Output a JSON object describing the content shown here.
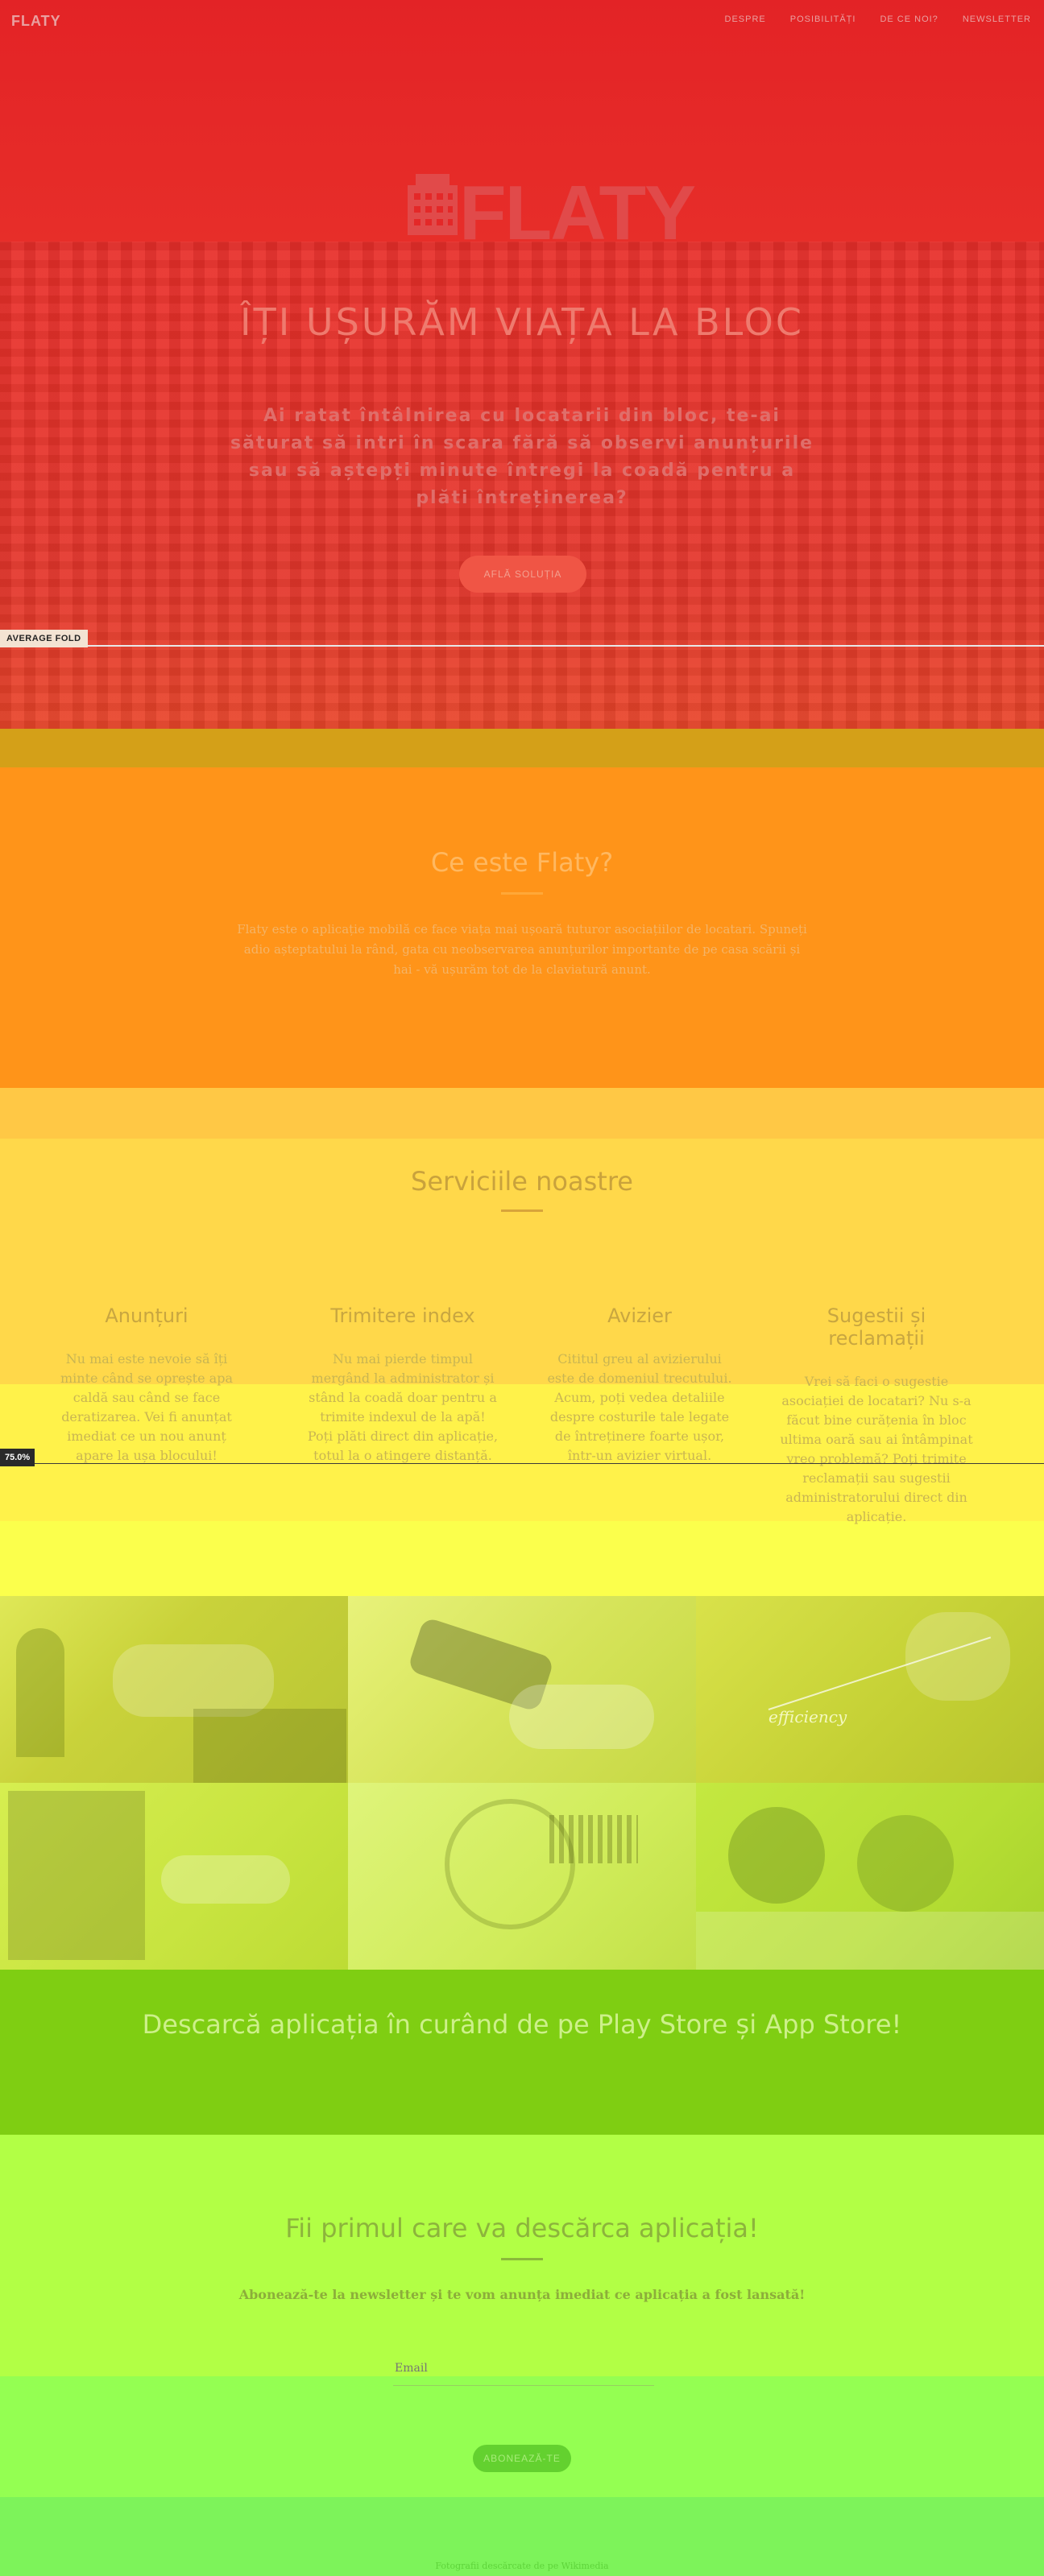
{
  "nav": {
    "brand": "FLATY",
    "links": [
      "DESPRE",
      "POSIBILITĂȚI",
      "DE CE NOI?",
      "NEWSLETTER"
    ]
  },
  "hero": {
    "logo_text": "FLATY",
    "title": "ÎȚI UȘURĂM VIAȚA LA BLOC",
    "subtitle": "Ai ratat întâlnirea cu locatarii din bloc, te-ai săturat să intri în scara fără să observi anunțurile sau să aștepți minute întregi la coadă pentru a plăti întreținerea?",
    "cta": "AFLĂ SOLUȚIA"
  },
  "heatmap_overlay": {
    "fold_label": "AVERAGE FOLD",
    "scroll_label": "75.0%"
  },
  "about": {
    "title": "Ce este Flaty?",
    "text": "Flaty este o aplicație mobilă ce face viața mai ușoară tuturor asociațiilor de locatari. Spuneți adio așteptatului la rând, gata cu neobservarea anunțurilor importante de pe casa scării și hai - vă ușurăm tot de la claviatură anunt."
  },
  "services": {
    "title": "Serviciile noastre",
    "items": [
      {
        "title": "Anunțuri",
        "text": "Nu mai este nevoie să îți minte când se oprește apa caldă sau când se face deratizarea. Vei fi anunțat imediat ce un nou anunț apare la ușa blocului!"
      },
      {
        "title": "Trimitere index",
        "text": "Nu mai pierde timpul mergând la administrator și stând la coadă doar pentru a trimite indexul de la apă! Poți plăti direct din aplicație, totul la o atingere distanță."
      },
      {
        "title": "Avizier",
        "text": "Cititul greu al avizierului este de domeniul trecutului. Acum, poți vedea detaliile despre costurile tale legate de întreținere foarte ușor, într-un avizier virtual."
      },
      {
        "title": "Sugestii și reclamații",
        "text": "Vrei să faci o sugestie asociației de locatari? Nu s-a făcut bine curățenia în bloc ultima oară sau ai întâmpinat vreo problemă? Poți trimite reclamații sau sugestii administratorului direct din aplicație."
      }
    ]
  },
  "photos": {
    "efficiency_caption": "efficiency"
  },
  "download": {
    "title": "Descarcă aplicația în curând de pe Play Store și App Store!"
  },
  "newsletter": {
    "title": "Fii primul care va descărca aplicația!",
    "subtitle": "Abonează-te la newsletter și te vom anunța imediat ce aplicația a fost lansată!",
    "email_placeholder": "Email",
    "button": "ABONEAZĂ-TE"
  },
  "footer": {
    "text": "Fotografii descărcate de pe Wikimedia"
  },
  "colors": {
    "hero": "#e42828",
    "about": "#ff9419",
    "services": "#ffd84a",
    "download": "#7fce12",
    "newsletter": "#b6ff45"
  }
}
